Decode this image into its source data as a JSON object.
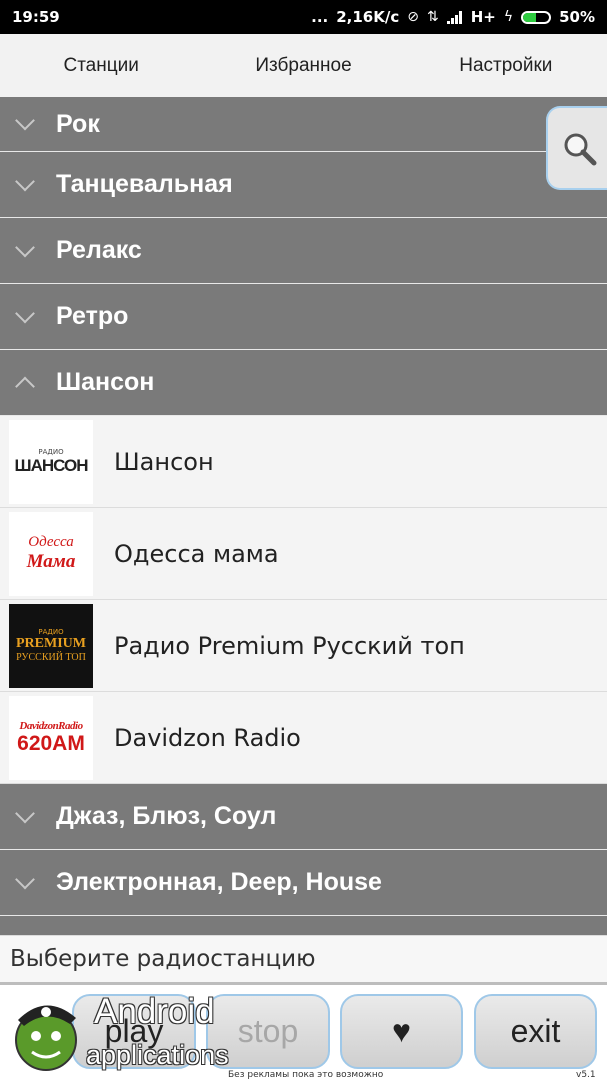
{
  "status_bar": {
    "time": "19:59",
    "dots": "...",
    "speed": "2,16K/c",
    "network": "H+",
    "battery": "50%",
    "battery_level": 0.5
  },
  "tabs": [
    {
      "label": "Станции"
    },
    {
      "label": "Избранное"
    },
    {
      "label": "Настройки"
    }
  ],
  "categories_top": [
    {
      "label": "Рок"
    },
    {
      "label": "Танцевальная"
    },
    {
      "label": "Релакс"
    },
    {
      "label": "Ретро"
    },
    {
      "label": "Шансон"
    }
  ],
  "stations": [
    {
      "name": "Шансон",
      "logo_text": "ШАНСОН",
      "logo_small": "РАДИО"
    },
    {
      "name": "Одесса мама",
      "logo_text": "Одесса",
      "logo_text2": "Мама"
    },
    {
      "name": "Радио Premium Русский топ",
      "logo_small": "РАДИО",
      "logo_text": "PREMIUM",
      "logo_text2": "РУССКИЙ ТОП"
    },
    {
      "name": "Davidzon Radio",
      "logo_text": "DavidzonRadio",
      "logo_text2": "620AM"
    }
  ],
  "categories_bottom": [
    {
      "label": "Джаз, Блюз, Соул"
    },
    {
      "label": "Электронная, Deep, House"
    }
  ],
  "prompt": "Выберите радиостанцию",
  "controls": {
    "play": "play",
    "stop": "stop",
    "fav": "♥",
    "exit": "exit"
  },
  "footnote": "Без рекламы пока это возможно",
  "version": "v5.1",
  "watermark": {
    "line1": "Android",
    "line2": "applications"
  },
  "colors": {
    "category_bg": "#7a7a7a",
    "station_bg": "#f4f4f4",
    "button_border": "#9fc8e8",
    "battery_fill": "#2ecc40"
  }
}
